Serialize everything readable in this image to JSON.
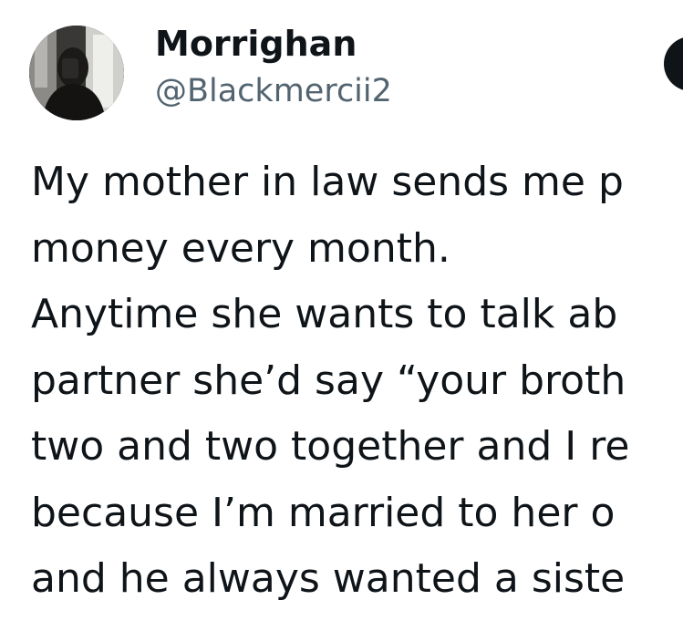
{
  "author": {
    "display_name": "Morrighan",
    "handle": "@Blackmercii2"
  },
  "tweet": {
    "lines": [
      "My mother in law sends me p",
      "money every month.",
      "Anytime she wants to talk ab",
      "partner she’d say “your broth",
      "two and two together and I re",
      "because I’m married to her o",
      "and he always wanted a siste"
    ]
  },
  "colors": {
    "text": "#0f1419",
    "secondary_text": "#536471",
    "button": "#0f1419",
    "background": "#ffffff"
  }
}
